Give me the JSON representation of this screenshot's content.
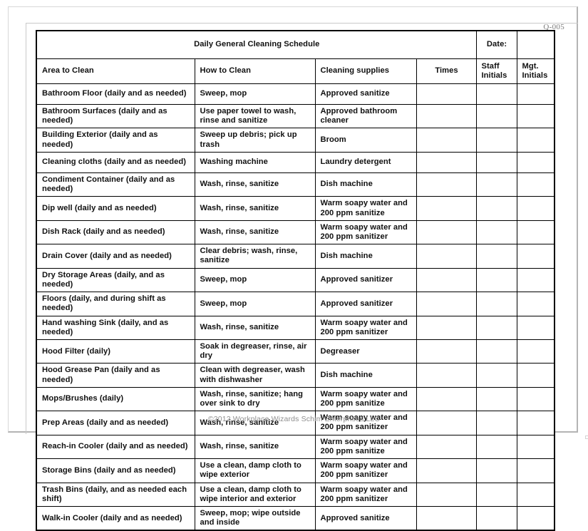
{
  "document": {
    "code": "Q-005",
    "footer": "©2012 Workplace Wizards Schim Enterprises LLC"
  },
  "header": {
    "title": "Daily General Cleaning Schedule",
    "date_label": "Date:",
    "date_value": ""
  },
  "columns": [
    {
      "key": "area",
      "label": "Area to Clean"
    },
    {
      "key": "how",
      "label": "How to Clean"
    },
    {
      "key": "supplies",
      "label": "Cleaning supplies"
    },
    {
      "key": "times",
      "label": "Times"
    },
    {
      "key": "staff",
      "label": "Staff\nInitials"
    },
    {
      "key": "mgt",
      "label": "Mgt.\nInitials"
    }
  ],
  "column_labels": {
    "area": "Area to Clean",
    "how": "How to Clean",
    "supplies": "Cleaning supplies",
    "times": "Times",
    "staff_line1": "Staff",
    "staff_line2": "Initials",
    "mgt_line1": "Mgt.",
    "mgt_line2": "Initials"
  },
  "rows": [
    {
      "area": "Bathroom Floor (daily and as needed)",
      "how": "Sweep, mop",
      "supplies": "Approved sanitize",
      "times": "",
      "staff": "",
      "mgt": ""
    },
    {
      "area": "Bathroom Surfaces (daily and as needed)",
      "how": "Use paper towel to wash, rinse and sanitize",
      "supplies": "Approved bathroom cleaner",
      "times": "",
      "staff": "",
      "mgt": ""
    },
    {
      "area": "Building Exterior (daily and as needed)",
      "how": "Sweep up debris; pick up trash",
      "supplies": "Broom",
      "times": "",
      "staff": "",
      "mgt": ""
    },
    {
      "area": "Cleaning cloths (daily and as needed)",
      "how": "Washing machine",
      "supplies": "Laundry detergent",
      "times": "",
      "staff": "",
      "mgt": ""
    },
    {
      "area": "Condiment Container (daily and as needed)",
      "how": "Wash, rinse, sanitize",
      "supplies": "Dish machine",
      "times": "",
      "staff": "",
      "mgt": ""
    },
    {
      "area": "Dip well (daily and as needed)",
      "how": "Wash, rinse, sanitize",
      "supplies": "Warm soapy water and 200 ppm sanitize",
      "times": "",
      "staff": "",
      "mgt": ""
    },
    {
      "area": "Dish Rack (daily and as needed)",
      "how": "Wash, rinse, sanitize",
      "supplies": "Warm soapy water and 200 ppm sanitizer",
      "times": "",
      "staff": "",
      "mgt": ""
    },
    {
      "area": "Drain Cover (daily and as needed)",
      "how": "Clear debris; wash, rinse, sanitize",
      "supplies": "Dish machine",
      "times": "",
      "staff": "",
      "mgt": ""
    },
    {
      "area": "Dry Storage Areas (daily, and as needed)",
      "how": "Sweep, mop",
      "supplies": "Approved sanitizer",
      "times": "",
      "staff": "",
      "mgt": ""
    },
    {
      "area": "Floors (daily, and during shift as needed)",
      "how": "Sweep, mop",
      "supplies": "Approved sanitizer",
      "times": "",
      "staff": "",
      "mgt": ""
    },
    {
      "area": "Hand washing Sink (daily, and as needed)",
      "how": "Wash, rinse, sanitize",
      "supplies": "Warm soapy water and 200 ppm sanitizer",
      "times": "",
      "staff": "",
      "mgt": ""
    },
    {
      "area": "Hood Filter (daily)",
      "how": "Soak in degreaser, rinse, air dry",
      "supplies": "Degreaser",
      "times": "",
      "staff": "",
      "mgt": ""
    },
    {
      "area": "Hood Grease Pan (daily and as needed)",
      "how": "Clean with degreaser, wash with dishwasher",
      "supplies": "Dish machine",
      "times": "",
      "staff": "",
      "mgt": ""
    },
    {
      "area": "Mops/Brushes (daily)",
      "how": "Wash, rinse, sanitize; hang over sink to dry",
      "supplies": "Warm soapy water and 200 ppm sanitize",
      "times": "",
      "staff": "",
      "mgt": ""
    },
    {
      "area": "Prep Areas (daily and as needed)",
      "how": "Wash, rinse, sanitize",
      "supplies": "Warm soapy water and 200 ppm sanitizer",
      "times": "",
      "staff": "",
      "mgt": ""
    },
    {
      "area": "Reach-in Cooler (daily and as needed)",
      "how": "Wash, rinse, sanitize",
      "supplies": "Warm soapy water and 200 ppm sanitize",
      "times": "",
      "staff": "",
      "mgt": ""
    },
    {
      "area": "Storage Bins (daily and as needed)",
      "how": "Use a clean, damp cloth to wipe exterior",
      "supplies": "Warm soapy water and 200 ppm sanitizer",
      "times": "",
      "staff": "",
      "mgt": ""
    },
    {
      "area": "Trash Bins (daily, and as needed each shift)",
      "how": "Use a clean, damp cloth to wipe interior and exterior",
      "supplies": "Warm soapy water and 200 ppm sanitizer",
      "times": "",
      "staff": "",
      "mgt": ""
    },
    {
      "area": "Walk-in Cooler (daily and as needed)",
      "how": "Sweep, mop; wipe outside and inside",
      "supplies": "Approved sanitize",
      "times": "",
      "staff": "",
      "mgt": ""
    }
  ],
  "colors": {
    "header_fill": "#b8dcea",
    "grid_line": "#000000",
    "footer_text": "#8e8e8e",
    "page_frame": "#b4b4b4"
  }
}
